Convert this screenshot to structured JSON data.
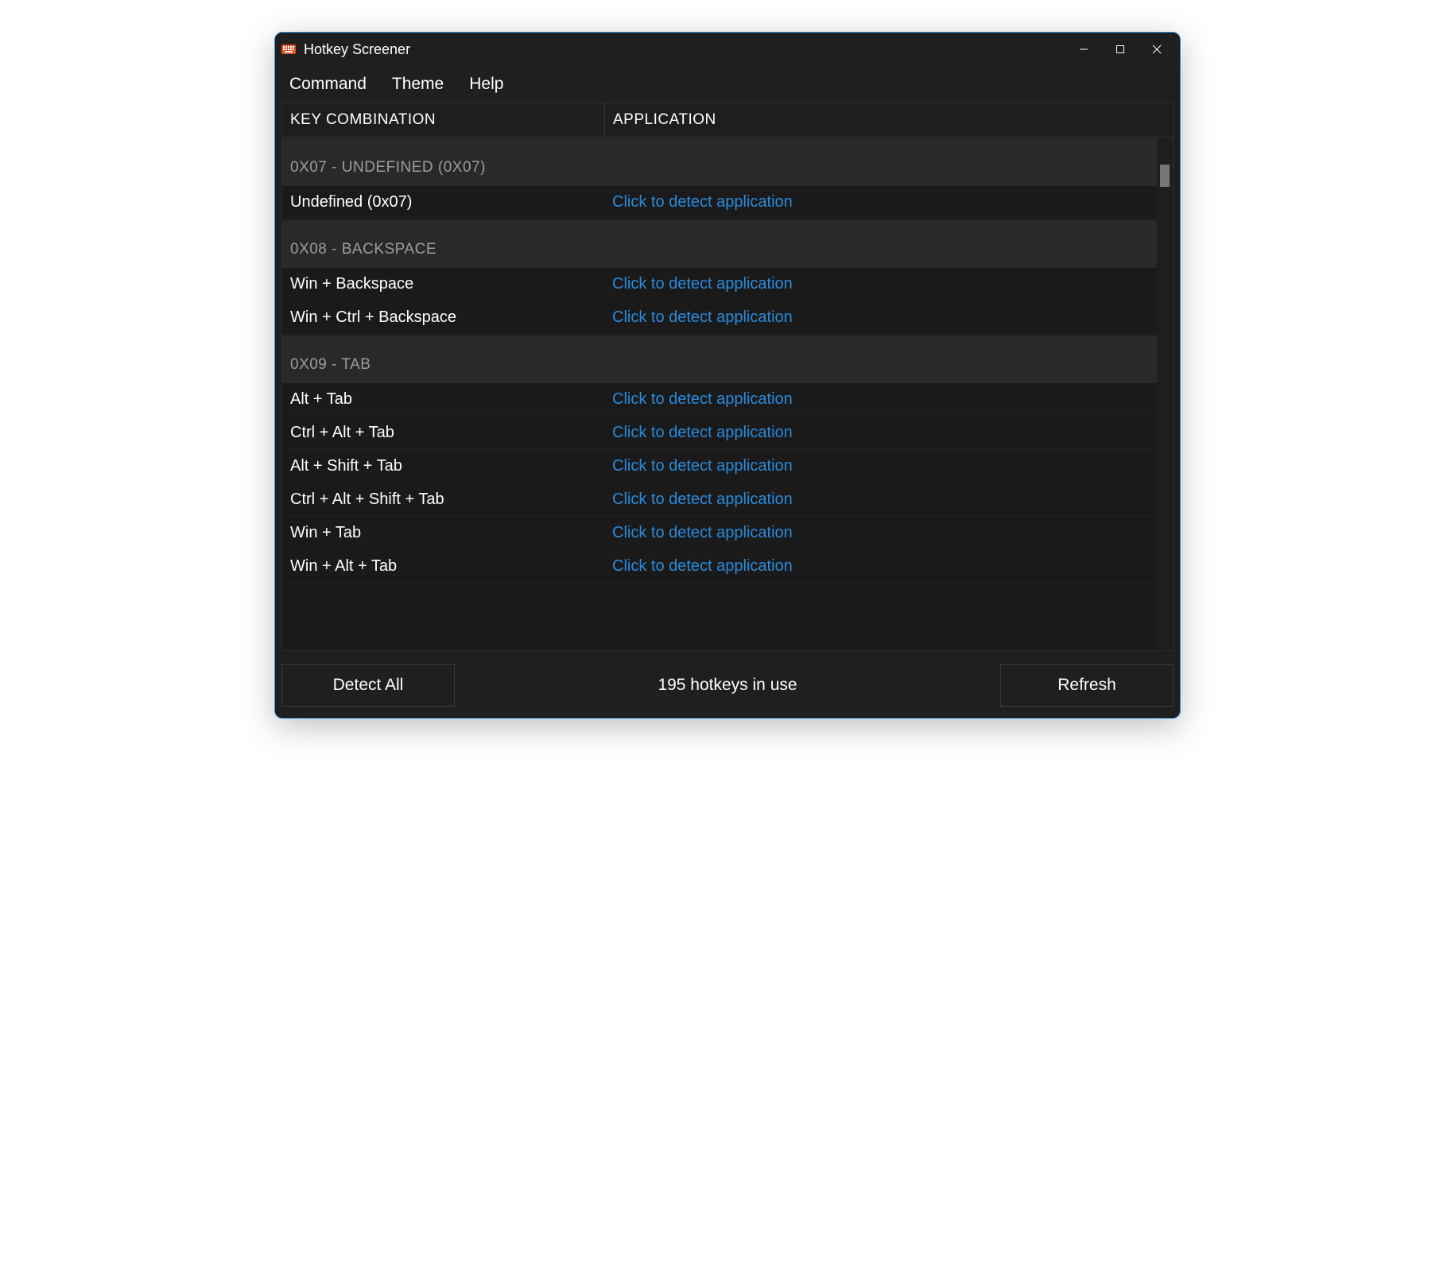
{
  "window": {
    "title": "Hotkey Screener"
  },
  "menu": {
    "command": "Command",
    "theme": "Theme",
    "help": "Help"
  },
  "columns": {
    "key": "KEY COMBINATION",
    "app": "APPLICATION"
  },
  "detect_label": "Click to detect application",
  "groups": [
    {
      "title": "0X07 - UNDEFINED (0X07)",
      "rows": [
        {
          "key": "Undefined (0x07)"
        }
      ]
    },
    {
      "title": "0X08 - BACKSPACE",
      "rows": [
        {
          "key": "Win + Backspace"
        },
        {
          "key": "Win + Ctrl + Backspace"
        }
      ]
    },
    {
      "title": "0X09 - TAB",
      "rows": [
        {
          "key": "Alt + Tab"
        },
        {
          "key": "Ctrl + Alt + Tab"
        },
        {
          "key": "Alt + Shift + Tab"
        },
        {
          "key": "Ctrl + Alt + Shift + Tab"
        },
        {
          "key": "Win + Tab"
        },
        {
          "key": "Win + Alt + Tab"
        }
      ]
    }
  ],
  "footer": {
    "detect_all": "Detect All",
    "status": "195 hotkeys in use",
    "refresh": "Refresh"
  }
}
